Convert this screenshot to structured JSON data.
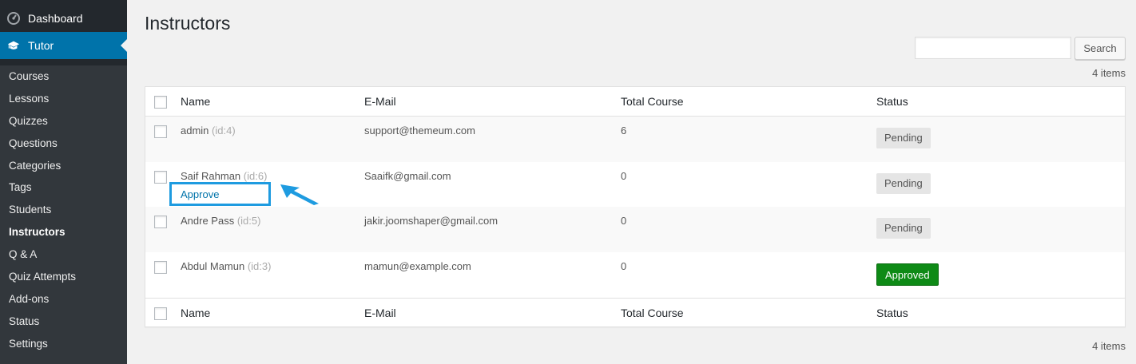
{
  "sidebar": {
    "dashboard_label": "Dashboard",
    "tutor_label": "Tutor",
    "submenu": [
      {
        "label": "Courses",
        "current": false
      },
      {
        "label": "Lessons",
        "current": false
      },
      {
        "label": "Quizzes",
        "current": false
      },
      {
        "label": "Questions",
        "current": false
      },
      {
        "label": "Categories",
        "current": false
      },
      {
        "label": "Tags",
        "current": false
      },
      {
        "label": "Students",
        "current": false
      },
      {
        "label": "Instructors",
        "current": true
      },
      {
        "label": "Q & A",
        "current": false
      },
      {
        "label": "Quiz Attempts",
        "current": false
      },
      {
        "label": "Add-ons",
        "current": false
      },
      {
        "label": "Status",
        "current": false
      },
      {
        "label": "Settings",
        "current": false
      }
    ]
  },
  "page": {
    "title": "Instructors",
    "search_button": "Search",
    "search_value": "",
    "items_count": "4 items"
  },
  "table": {
    "columns": {
      "name": "Name",
      "email": "E-Mail",
      "total_course": "Total Course",
      "status": "Status"
    },
    "rows": [
      {
        "name": "admin",
        "id": "(id:4)",
        "email": "support@themeum.com",
        "total_course": "6",
        "status": "Pending"
      },
      {
        "name": "Saif Rahman",
        "id": "(id:6)",
        "email": "Saaifk@gmail.com",
        "total_course": "0",
        "status": "Pending",
        "action": "Approve"
      },
      {
        "name": "Andre Pass",
        "id": "(id:5)",
        "email": "jakir.joomshaper@gmail.com",
        "total_course": "0",
        "status": "Pending"
      },
      {
        "name": "Abdul Mamun",
        "id": "(id:3)",
        "email": "mamun@example.com",
        "total_course": "0",
        "status": "Approved"
      }
    ]
  },
  "colors": {
    "sidebar_bg": "#23282d",
    "submenu_bg": "#32373c",
    "active_menu": "#0073aa",
    "approved_badge": "#0e8a16",
    "highlight": "#1e9be0"
  }
}
